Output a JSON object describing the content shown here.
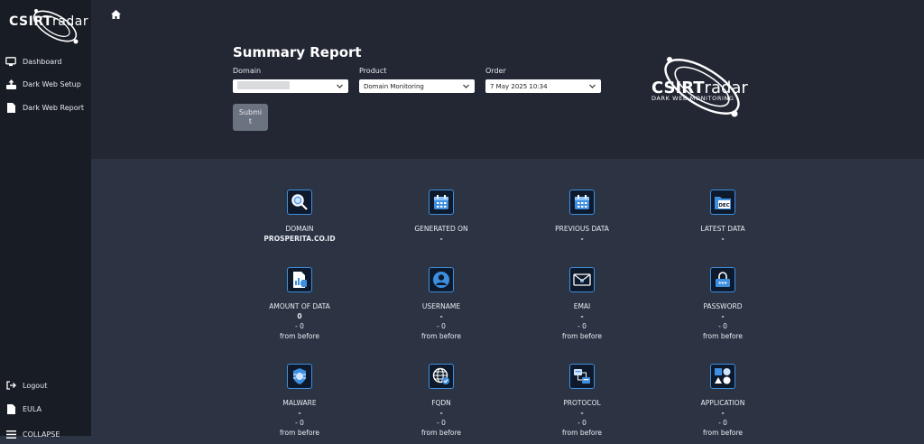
{
  "sidebar": {
    "logo": {
      "bold": "CSIRT",
      "thin": "radar"
    },
    "items": [
      {
        "label": "Dashboard",
        "icon": "monitor-icon"
      },
      {
        "label": "Dark Web Setup",
        "icon": "upload-icon"
      },
      {
        "label": "Dark Web Report",
        "icon": "file-icon"
      }
    ],
    "bottom_items": [
      {
        "label": "Logout",
        "icon": "logout-icon"
      },
      {
        "label": "EULA",
        "icon": "file-icon"
      },
      {
        "label": "COLLAPSE",
        "icon": "menu-icon"
      }
    ]
  },
  "header": {
    "title": "Summary Report",
    "domain_label": "Domain",
    "product_label": "Product",
    "product_value": "Domain Monitoring",
    "order_label": "Order",
    "order_value": "7 May 2025 10:34",
    "submit_line1": "Submi",
    "submit_line2": "t",
    "brand": {
      "bold": "CSIRT",
      "thin": "radar",
      "tagline": "DARK WEB MONITORING"
    }
  },
  "cards": [
    {
      "label": "DOMAIN",
      "value": "PROSPERITA.CO.ID",
      "icon": "search-icon"
    },
    {
      "label": "GENERATED ON",
      "value": "-",
      "icon": "calendar-icon"
    },
    {
      "label": "PREVIOUS DATA",
      "value": "-",
      "icon": "calendar-icon"
    },
    {
      "label": "LATEST DATA",
      "value": "-",
      "icon": "folder-dec-icon",
      "icon_text": "DEC"
    },
    {
      "label": "AMOUNT OF DATA",
      "value": "0",
      "change": "- 0",
      "from": "from before",
      "icon": "report-icon"
    },
    {
      "label": "USERNAME",
      "value": "-",
      "change": "- 0",
      "from": "from before",
      "icon": "user-icon"
    },
    {
      "label": "EMAI",
      "value": "-",
      "change": "- 0",
      "from": "from before",
      "icon": "mail-icon"
    },
    {
      "label": "PASSWORD",
      "value": "-",
      "change": "- 0",
      "from": "from before",
      "icon": "password-lock-icon",
      "icon_text": "***"
    },
    {
      "label": "MALWARE",
      "value": "-",
      "change": "- 0",
      "from": "from before",
      "icon": "bug-icon"
    },
    {
      "label": "FQDN",
      "value": "-",
      "change": "- 0",
      "from": "from before",
      "icon": "globe-icon"
    },
    {
      "label": "PROTOCOL",
      "value": "-",
      "change": "- 0",
      "from": "from before",
      "icon": "network-icon"
    },
    {
      "label": "APPLICATION",
      "value": "-",
      "change": "- 0",
      "from": "from before",
      "icon": "shapes-icon"
    }
  ],
  "colors": {
    "sidebar": "#181c24",
    "header": "#222733",
    "content": "#2c3444",
    "icon_border": "#3d8fe0"
  }
}
